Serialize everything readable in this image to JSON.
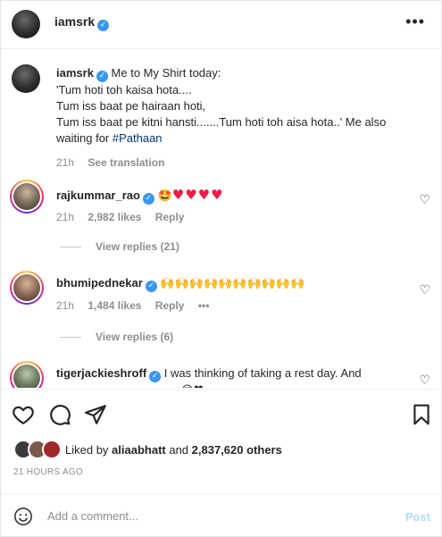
{
  "header": {
    "username": "iamsrk",
    "more_icon": "more-horizontal-icon"
  },
  "caption": {
    "username": "iamsrk",
    "lines": [
      "Me to My Shirt today:",
      "'Tum hoti toh kaisa hota....",
      "Tum iss baat pe hairaan hoti,",
      "Tum iss baat pe kitni hansti.......Tum hoti toh aisa hota..' Me also",
      "waiting for "
    ],
    "hashtag": "#Pathaan",
    "time": "21h",
    "see_translation": "See translation"
  },
  "comments": [
    {
      "username": "rajkummar_rao",
      "emoji": "🤩",
      "hearts": "♥♥♥♥",
      "time": "21h",
      "likes": "2,982 likes",
      "reply": "Reply",
      "view_replies": "View replies (21)"
    },
    {
      "username": "bhumipednekar",
      "emoji": "🙌🙌🙌🙌🙌🙌🙌🙌🙌🙌",
      "time": "21h",
      "likes": "1,484 likes",
      "reply": "Reply",
      "more": "•••",
      "view_replies": "View replies (6)"
    },
    {
      "username": "tigerjackieshroff",
      "text": "I was thinking of taking a rest day. And",
      "text2": "😍♥"
    }
  ],
  "actions": {
    "liked_by_prefix": "Liked by ",
    "liked_by_user": "aliaabhatt",
    "liked_by_and": " and ",
    "liked_by_count": "2,837,620 others",
    "time_ago": "21 HOURS AGO"
  },
  "add_comment": {
    "placeholder": "Add a comment...",
    "post_label": "Post"
  },
  "colors": {
    "verified": "#3897f0",
    "hashtag": "#00376b",
    "post_disabled": "#b3dbff",
    "heart": "#ed1b45"
  }
}
